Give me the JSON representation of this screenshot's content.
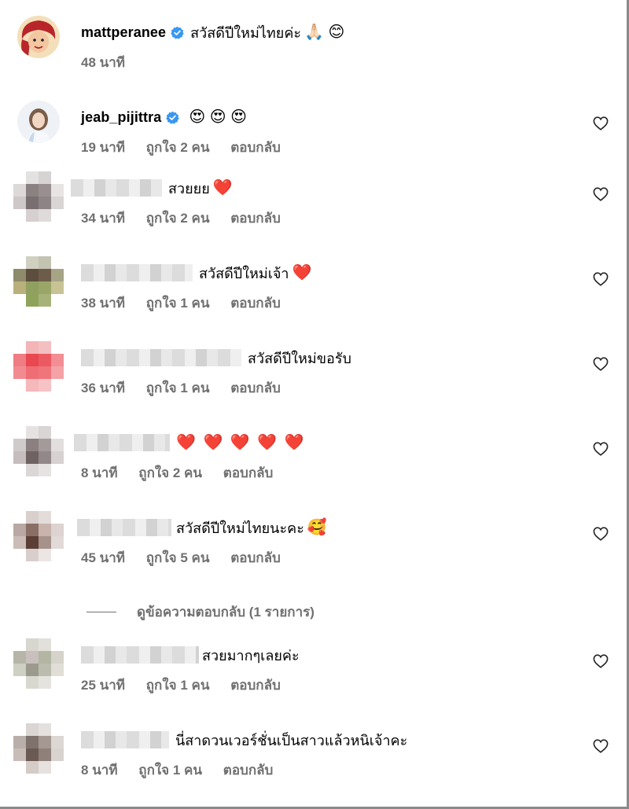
{
  "comments": [
    {
      "username": "mattperanee",
      "verified": true,
      "text": "สวัสดีปีใหม่ไทยค่ะ",
      "emoji": "🙏🏻 😊",
      "time": "48 นาที",
      "likes": "",
      "reply": "",
      "heart": false
    },
    {
      "username": "jeab_pijittra",
      "verified": true,
      "text": "",
      "emoji": "😍 😍 😍",
      "time": "19 นาที",
      "likes": "ถูกใจ 2 คน",
      "reply": "ตอบกลับ",
      "heart": true
    },
    {
      "username": "",
      "verified": false,
      "text": "สวยยย",
      "emoji": "❤️",
      "time": "34 นาที",
      "likes": "ถูกใจ 2 คน",
      "reply": "ตอบกลับ",
      "heart": true
    },
    {
      "username": "",
      "verified": false,
      "text": "สวัสดีปีใหม่เจ้า",
      "emoji": "❤️",
      "time": "38 นาที",
      "likes": "ถูกใจ 1 คน",
      "reply": "ตอบกลับ",
      "heart": true
    },
    {
      "username": "",
      "verified": false,
      "text": "สวัสดีปีใหม่ขอรับ",
      "emoji": "",
      "time": "36 นาที",
      "likes": "ถูกใจ 1 คน",
      "reply": "ตอบกลับ",
      "heart": true
    },
    {
      "username": "",
      "verified": false,
      "text": "",
      "emoji": "❤️ ❤️ ❤️ ❤️ ❤️",
      "time": "8 นาที",
      "likes": "ถูกใจ 2 คน",
      "reply": "ตอบกลับ",
      "heart": true
    },
    {
      "username": "",
      "verified": false,
      "text": "สวัสดีปีใหม่ไทยนะคะ",
      "emoji": "🥰",
      "time": "45 นาที",
      "likes": "ถูกใจ 5 คน",
      "reply": "ตอบกลับ",
      "heart": true
    },
    {
      "username": "",
      "verified": false,
      "text": "สวยมากๆเลยค่ะ",
      "emoji": "",
      "time": "25 นาที",
      "likes": "ถูกใจ 1 คน",
      "reply": "ตอบกลับ",
      "heart": true
    },
    {
      "username": "",
      "verified": false,
      "text": "นี่สาดวนเวอร์ชั่นเป็นสาวแล้วหนิเจ้าคะ",
      "emoji": "",
      "time": "8 นาที",
      "likes": "ถูกใจ 1 คน",
      "reply": "ตอบกลับ",
      "heart": true
    }
  ],
  "view_replies": "ดูข้อความตอบกลับ (1 รายการ)",
  "colors": {
    "verified": "#3897f0",
    "meta": "#707070",
    "heart_emoji": "#e0245e"
  },
  "icons": {
    "verified": "verified-badge-icon",
    "like": "heart-outline-icon"
  }
}
